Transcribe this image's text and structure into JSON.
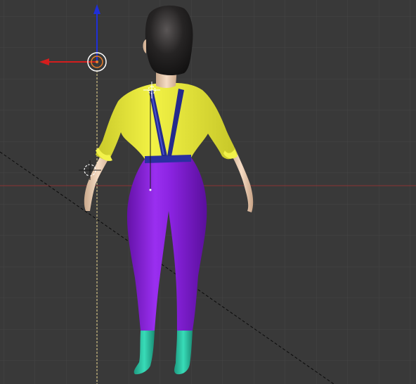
{
  "app": {
    "name": "3D Viewport"
  },
  "viewport": {
    "background_color": "#393939",
    "grid": "on",
    "grid_color": "#454545",
    "view_axis_red": "#b43c3c",
    "view_axis_dashed": "#e6d48a"
  },
  "gizmo": {
    "z_axis_color": "#1f2fd8",
    "x_axis_color": "#d41d1d",
    "x_direction": "left",
    "z_direction": "up"
  },
  "scene": {
    "object": "character",
    "view": "back",
    "colors": {
      "hair": "#1e1c1c",
      "skin": "#f1d7bf",
      "shirt": "#e8ea3a",
      "suspenders": "#2a2fa0",
      "pants": "#8a1fd8",
      "boots": "#2cc8a6"
    },
    "icons": [
      "object-origin-icon",
      "cursor-3d-icon",
      "origin-marker-icon",
      "transform-gizmo-icon"
    ]
  }
}
